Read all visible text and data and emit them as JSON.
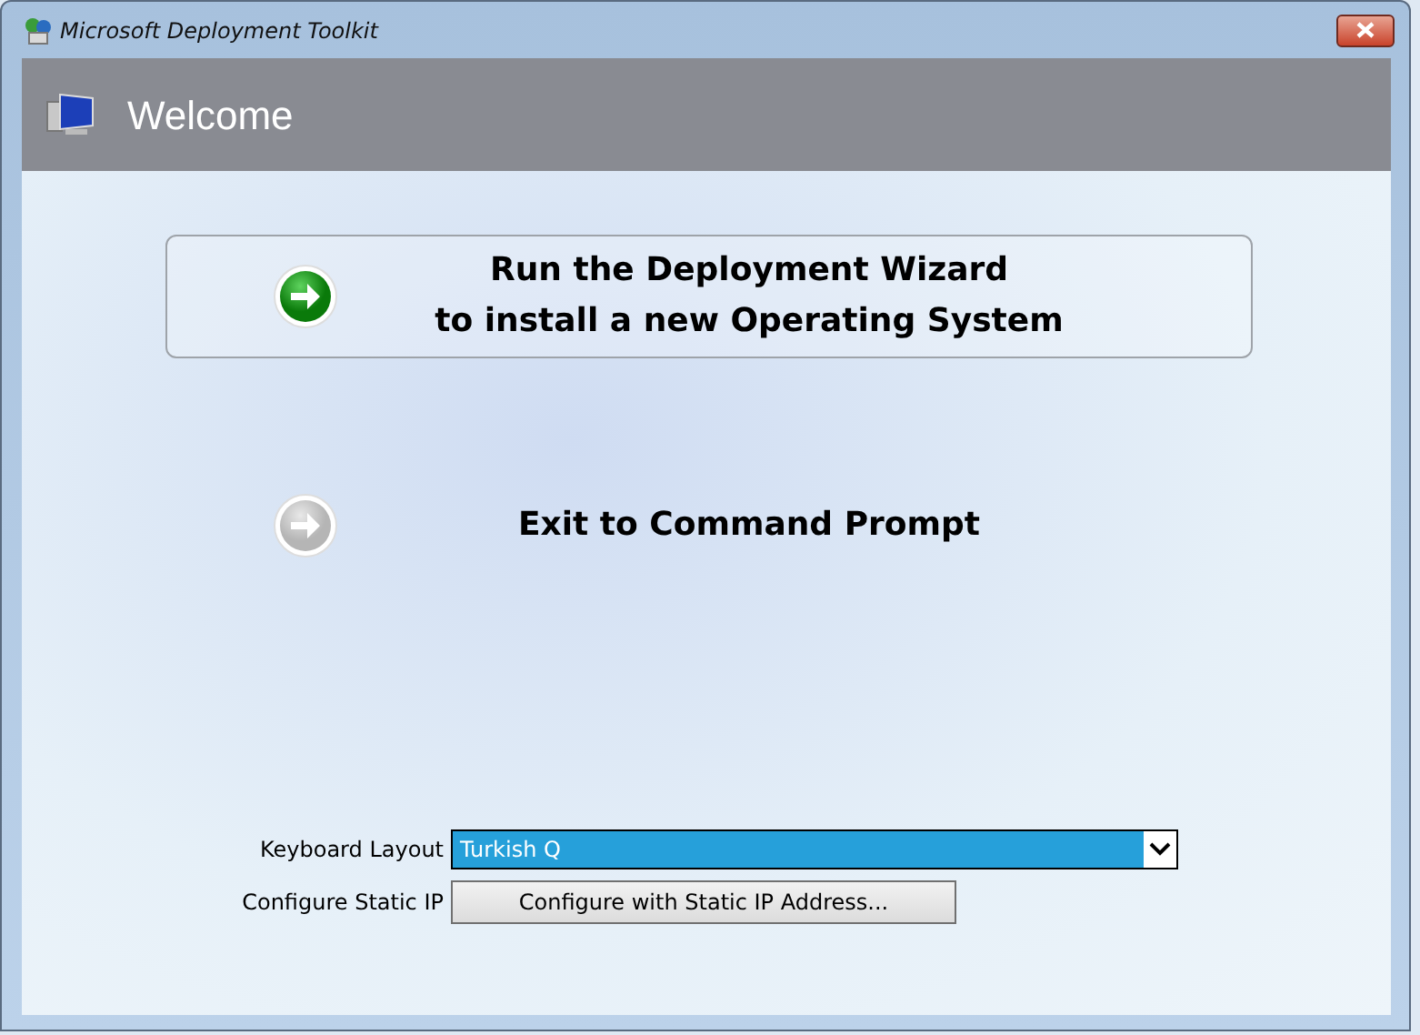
{
  "window": {
    "title": "Microsoft Deployment Toolkit"
  },
  "header": {
    "title": "Welcome"
  },
  "actions": [
    {
      "lines": [
        "Run the Deployment Wizard",
        "to install a new Operating System"
      ],
      "selected": true
    },
    {
      "lines": [
        "Exit to Command Prompt"
      ],
      "selected": false
    }
  ],
  "form": [
    {
      "kind": "select",
      "label": "Keyboard Layout",
      "value": "Turkish Q"
    },
    {
      "kind": "button",
      "label": "Configure Static IP",
      "value": "Configure with Static IP Address..."
    }
  ]
}
